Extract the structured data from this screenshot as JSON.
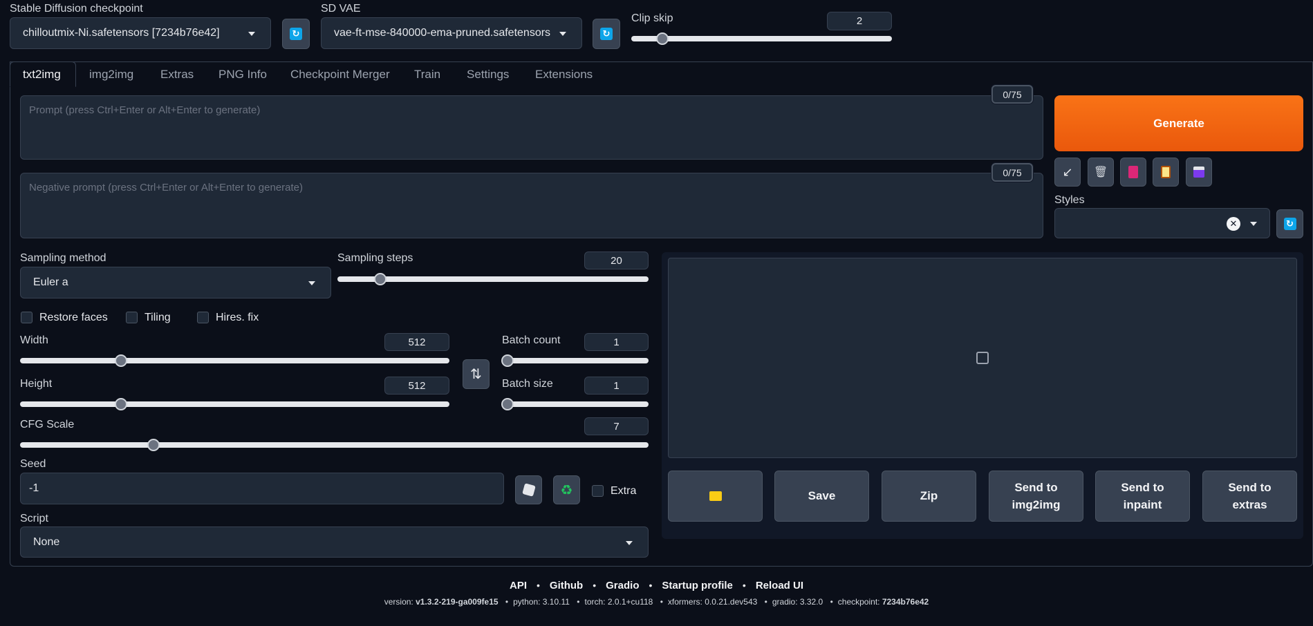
{
  "top": {
    "checkpoint_label": "Stable Diffusion checkpoint",
    "checkpoint_value": "chilloutmix-Ni.safetensors [7234b76e42]",
    "vae_label": "SD VAE",
    "vae_value": "vae-ft-mse-840000-ema-pruned.safetensors",
    "clip_skip_label": "Clip skip",
    "clip_skip_value": "2"
  },
  "tabs": [
    "txt2img",
    "img2img",
    "Extras",
    "PNG Info",
    "Checkpoint Merger",
    "Train",
    "Settings",
    "Extensions"
  ],
  "prompt": {
    "placeholder": "Prompt (press Ctrl+Enter or Alt+Enter to generate)",
    "token_count": "0/75",
    "neg_placeholder": "Negative prompt (press Ctrl+Enter or Alt+Enter to generate)",
    "neg_token_count": "0/75"
  },
  "generate_label": "Generate",
  "styles_label": "Styles",
  "sampling": {
    "method_label": "Sampling method",
    "method_value": "Euler a",
    "steps_label": "Sampling steps",
    "steps_value": "20"
  },
  "checkboxes": {
    "restore_faces": "Restore faces",
    "tiling": "Tiling",
    "hires_fix": "Hires. fix"
  },
  "dims": {
    "width_label": "Width",
    "width_value": "512",
    "height_label": "Height",
    "height_value": "512",
    "batch_count_label": "Batch count",
    "batch_count_value": "1",
    "batch_size_label": "Batch size",
    "batch_size_value": "1",
    "swap_icon": "⇅"
  },
  "cfg": {
    "label": "CFG Scale",
    "value": "7"
  },
  "seed": {
    "label": "Seed",
    "value": "-1",
    "extra_label": "Extra"
  },
  "script": {
    "label": "Script",
    "value": "None"
  },
  "output_buttons": {
    "save": "Save",
    "zip": "Zip",
    "send_img2img": "Send to img2img",
    "send_inpaint": "Send to inpaint",
    "send_extras": "Send to extras"
  },
  "footer": {
    "links": [
      "API",
      "Github",
      "Gradio",
      "Startup profile",
      "Reload UI"
    ],
    "version_label": "version:",
    "version": "v1.3.2-219-ga009fe15",
    "python": "python: 3.10.11",
    "torch": "torch: 2.0.1+cu118",
    "xformers": "xformers: 0.0.21.dev543",
    "gradio": "gradio: 3.32.0",
    "checkpoint_label": "checkpoint:",
    "checkpoint": "7234b76e42"
  },
  "colors": {
    "generate": "#f97316",
    "accent_refresh": "#0ea5e9",
    "background": "#0b0f19"
  }
}
